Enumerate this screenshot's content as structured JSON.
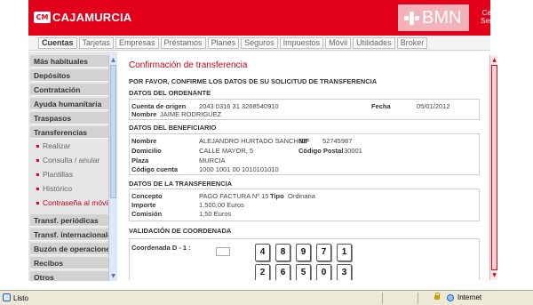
{
  "header": {
    "logo_mark": "CM",
    "logo_text": "CAJAMURCIA",
    "partner_logo": "BMN",
    "exit_line1": "Cerrar",
    "exit_line2": "Sesión"
  },
  "nav_tabs": [
    "Cuentas",
    "Tarjetas",
    "Empresas",
    "Préstamos",
    "Planes",
    "Seguros",
    "Impuestos",
    "Móvil",
    "Utilidades",
    "Broker"
  ],
  "sidebar": {
    "sections": [
      "Más habituales",
      "Depósitos",
      "Contratación",
      "Ayuda humanitaria",
      "Traspasos",
      "Transferencias"
    ],
    "subitems": [
      "Realizar",
      "Consulta / anular",
      "Plantillas",
      "Histórico",
      "Contraseña al móvil"
    ],
    "sections_after": [
      "Transf. periódicas",
      "Transf. internacionales",
      "Buzón de operaciones",
      "Recibos",
      "Otros"
    ]
  },
  "content": {
    "title": "Confirmación de transferencia",
    "intro": "POR FAVOR, CONFIRME LOS DATOS DE SU SOLICITUD DE TRANSFERENCIA",
    "ordenante": {
      "section": "DATOS DEL ORDENANTE",
      "cuenta_label": "Cuenta de origen",
      "cuenta_value": "2043 0316 31  3268540910",
      "fecha_label": "Fecha",
      "fecha_value": "05/01/2012",
      "nombre_label": "Nombre",
      "nombre_value": "JAIME RODRIGUEZ"
    },
    "beneficiario": {
      "section": "DATOS DEL BENEFICIARIO",
      "nombre_label": "Nombre",
      "nombre_value": "ALEJANDRO HURTADO SANCHEZ",
      "nif_label": "NIF",
      "nif_value": "52745987",
      "domicilio_label": "Domicilio",
      "domicilio_value": "CALLE MAYOR, 5",
      "cp_label": "Código Postal",
      "cp_value": "30001",
      "plaza_label": "Plaza",
      "plaza_value": "MURCIA",
      "codigo_label": "Código cuenta",
      "codigo_value": "1000 1001 00 1010101010"
    },
    "transferencia": {
      "section": "DATOS DE LA TRANSFERENCIA",
      "concepto_label": "Concepto",
      "concepto_value": "PAGO FACTURA Nº 15",
      "tipo_label": "Tipo",
      "tipo_value": "Ordinaria",
      "importe_label": "Importe",
      "importe_value": "1.500,00 Euros",
      "comision_label": "Comisión",
      "comision_value": "1,50 Euros"
    },
    "coordenada": {
      "section": "VALIDACIÓN DE COORDENADA",
      "label": "Coordenada D - 1 :",
      "input_value": "",
      "keypad_row1": [
        "4",
        "8",
        "9",
        "7",
        "1"
      ],
      "keypad_row2": [
        "2",
        "6",
        "5",
        "0",
        "3"
      ]
    }
  },
  "statusbar": {
    "left": "Listo",
    "zone": "Internet"
  }
}
